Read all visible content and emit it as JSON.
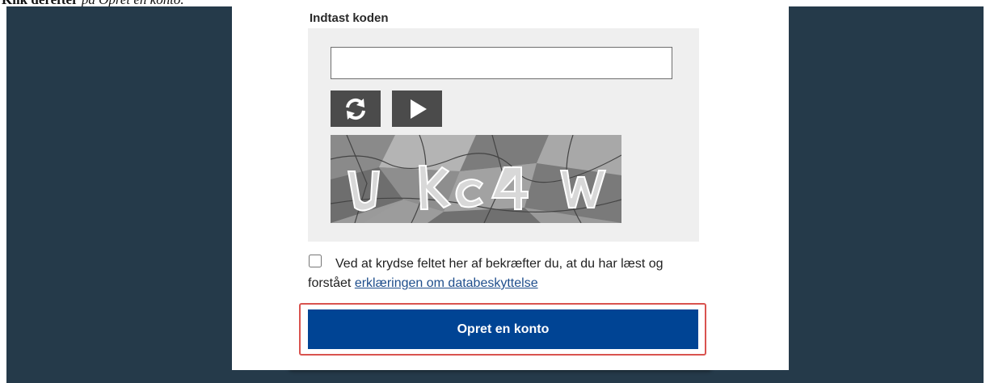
{
  "caption": {
    "lead": "Klik derefter",
    "middle": "på",
    "target": "Opret en konto."
  },
  "form": {
    "code_label": "Indtast koden",
    "code_input": {
      "value": "",
      "placeholder": ""
    },
    "refresh_icon": "refresh-icon",
    "play_icon": "play-audio-icon",
    "captcha_text": "ukc4w",
    "consent": {
      "checked": false,
      "text": "Ved at krydse feltet her af bekræfter du, at du har læst og forstået ",
      "link": "erklæringen om databeskyttelse"
    },
    "submit_label": "Opret en konto"
  },
  "colors": {
    "backdrop": "#253a4a",
    "panel": "#ffffff",
    "captcha_box": "#efefef",
    "button_primary": "#004494",
    "highlight": "#d9534f"
  }
}
